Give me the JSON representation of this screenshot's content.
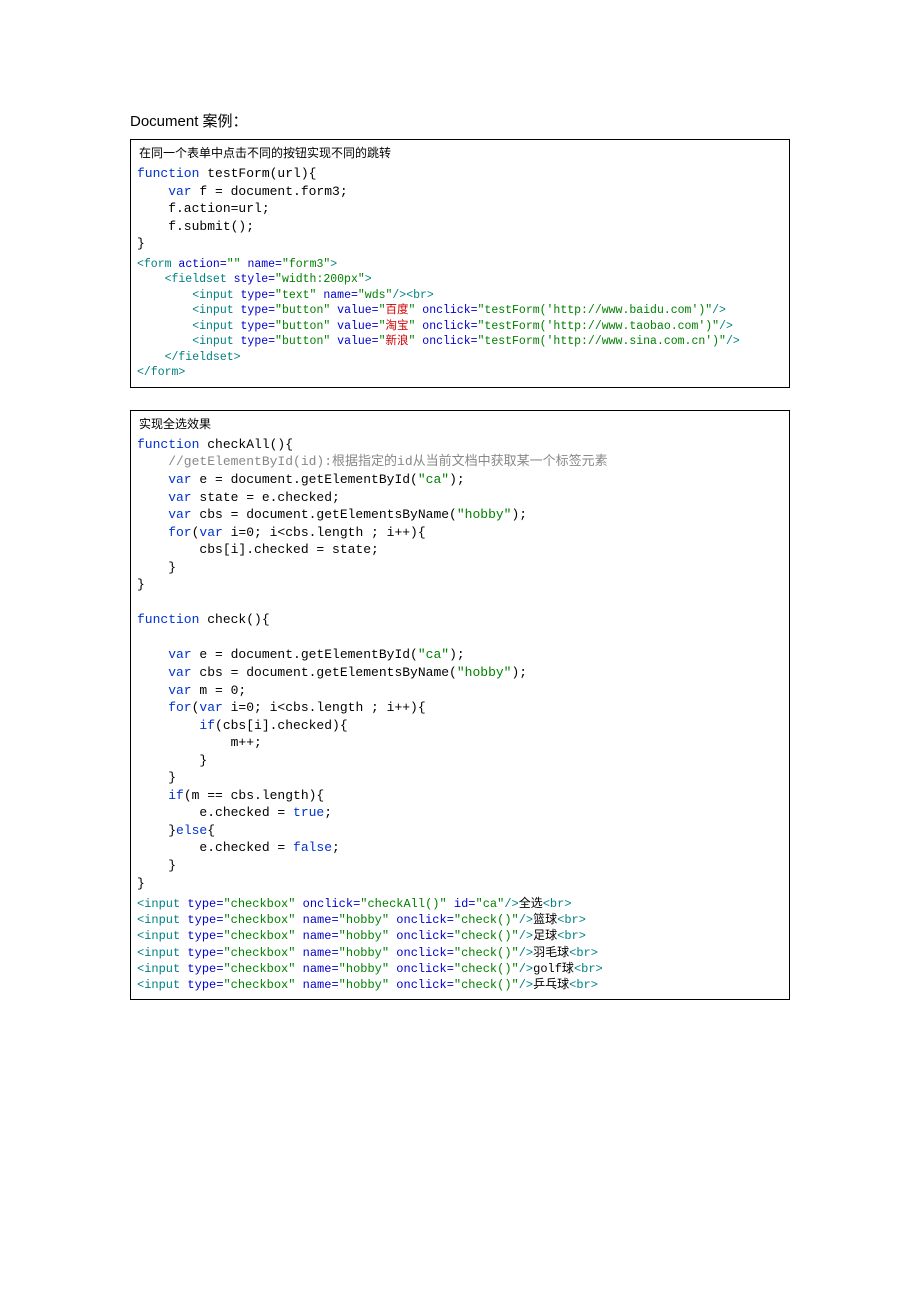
{
  "title": "Document 案例：",
  "section1": {
    "title": "在同一个表单中点击不同的按钮实现不同的跳转",
    "js": {
      "l1_a": "function",
      "l1_b": " testForm(url){",
      "l2_a": "    var",
      "l2_b": " f = document.form3;",
      "l3": "    f.action=url;",
      "l4": "    f.submit();",
      "l5": "}"
    },
    "html": {
      "l1_a": "<form ",
      "l1_attr1": "action=",
      "l1_val1": "\"\"",
      "l1_attr2": " name=",
      "l1_val2": "\"form3\"",
      "l1_c": ">",
      "l2_a": "    <fieldset ",
      "l2_attr1": "style=",
      "l2_val1": "\"width:200px\"",
      "l2_c": ">",
      "l3_a": "        <input ",
      "l3_attr1": "type=",
      "l3_val1": "\"text\"",
      "l3_attr2": " name=",
      "l3_val2": "\"wds\"",
      "l3_c": "/><br>",
      "l4_a": "        <input ",
      "l4_attr1": "type=",
      "l4_val1": "\"button\"",
      "l4_attr2": " value=",
      "l4_val2a": "\"",
      "l4_val2b": "百度",
      "l4_val2c": "\"",
      "l4_attr3": " onclick=",
      "l4_val3": "\"testForm('http://www.baidu.com')\"",
      "l4_c": "/>",
      "l5_a": "        <input ",
      "l5_attr1": "type=",
      "l5_val1": "\"button\"",
      "l5_attr2": " value=",
      "l5_val2a": "\"",
      "l5_val2b": "淘宝",
      "l5_val2c": "\"",
      "l5_attr3": " onclick=",
      "l5_val3": "\"testForm('http://www.taobao.com')\"",
      "l5_c": "/>",
      "l6_a": "        <input ",
      "l6_attr1": "type=",
      "l6_val1": "\"button\"",
      "l6_attr2": " value=",
      "l6_val2a": "\"",
      "l6_val2b": "新浪",
      "l6_val2c": "\"",
      "l6_attr3": " onclick=",
      "l6_val3": "\"testForm('http://www.sina.com.cn')\"",
      "l6_c": "/>",
      "l7": "    </fieldset>",
      "l8": "</form>"
    }
  },
  "section2": {
    "title": "实现全选效果",
    "js": {
      "a1_a": "function",
      "a1_b": " checkAll(){",
      "a2": "    //getElementById(id):根据指定的id从当前文档中获取某一个标签元素",
      "a3_a": "    var",
      "a3_b": " e = document.getElementById(",
      "a3_c": "\"ca\"",
      "a3_d": ");",
      "a4_a": "    var",
      "a4_b": " state = e.checked;",
      "a5_a": "    var",
      "a5_b": " cbs = document.getElementsByName(",
      "a5_c": "\"hobby\"",
      "a5_d": ");",
      "a6_a": "    for",
      "a6_b": "(",
      "a6_c": "var",
      "a6_d": " i=0; i<cbs.length ; i++){",
      "a7": "        cbs[i].checked = state;",
      "a8": "    }",
      "a9": "}",
      "b1_a": "function",
      "b1_b": " check(){",
      "b3_a": "    var",
      "b3_b": " e = document.getElementById(",
      "b3_c": "\"ca\"",
      "b3_d": ");",
      "b4_a": "    var",
      "b4_b": " cbs = document.getElementsByName(",
      "b4_c": "\"hobby\"",
      "b4_d": ");",
      "b5_a": "    var",
      "b5_b": " m = 0;",
      "b6_a": "    for",
      "b6_b": "(",
      "b6_c": "var",
      "b6_d": " i=0; i<cbs.length ; i++){",
      "b7_a": "        if",
      "b7_b": "(cbs[i].checked){",
      "b8": "            m++;",
      "b9": "        }",
      "b10": "    }",
      "b11_a": "    if",
      "b11_b": "(m == cbs.length){",
      "b12_a": "        e.checked = ",
      "b12_b": "true",
      "b12_c": ";",
      "b13_a": "    }",
      "b13_b": "else",
      "b13_c": "{",
      "b14_a": "        e.checked = ",
      "b14_b": "false",
      "b14_c": ";",
      "b15": "    }",
      "b16": "}"
    },
    "html": {
      "c1_a": "<input ",
      "c1_attr1": "type=",
      "c1_val1": "\"checkbox\"",
      "c1_attr2": " onclick=",
      "c1_val2": "\"checkAll()\"",
      "c1_attr3": " id=",
      "c1_val3": "\"ca\"",
      "c1_c": "/>",
      "c1_txt": "全选",
      "c1_br": "<br>",
      "c2_a": "<input ",
      "c2_attr1": "type=",
      "c2_val1": "\"checkbox\"",
      "c2_attr2": " name=",
      "c2_val2": "\"hobby\"",
      "c2_attr3": " onclick=",
      "c2_val3": "\"check()\"",
      "c2_c": "/>",
      "c2_txt": "篮球",
      "c2_br": "<br>",
      "c3_txt": "足球",
      "c4_txt": "羽毛球",
      "c5_txt": "golf球",
      "c6_txt": "乒乓球"
    }
  }
}
